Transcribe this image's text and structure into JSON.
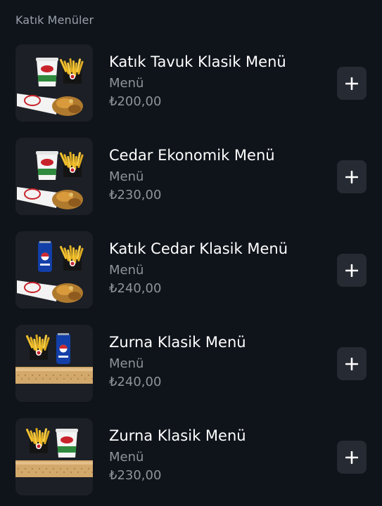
{
  "section": {
    "title": "Katık Menüler"
  },
  "items": [
    {
      "name": "Katık Tavuk Klasik Menü",
      "category": "Menü",
      "price": "₺200,00",
      "drink": "cup",
      "food": "wrap"
    },
    {
      "name": "Cedar Ekonomik Menü",
      "category": "Menü",
      "price": "₺230,00",
      "drink": "cup",
      "food": "wrap"
    },
    {
      "name": "Katık Cedar Klasik Menü",
      "category": "Menü",
      "price": "₺240,00",
      "drink": "can",
      "food": "wrap"
    },
    {
      "name": "Zurna Klasik Menü",
      "category": "Menü",
      "price": "₺240,00",
      "drink": "can",
      "food": "zurna"
    },
    {
      "name": "Zurna Klasik Menü",
      "category": "Menü",
      "price": "₺230,00",
      "drink": "cup",
      "food": "zurna"
    }
  ],
  "icons": {
    "add": "plus-icon"
  },
  "colors": {
    "background": "#0f131a",
    "button": "#262b33",
    "muted_text": "#8e949c"
  }
}
